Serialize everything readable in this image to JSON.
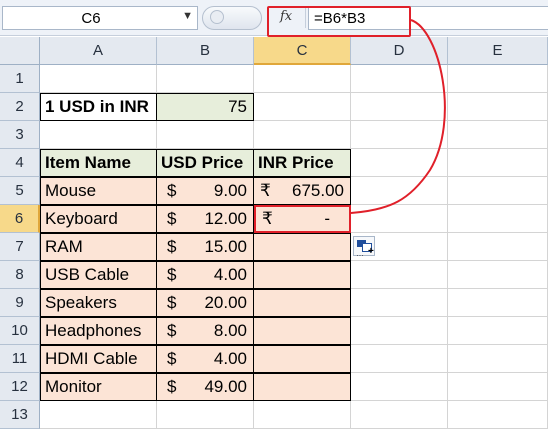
{
  "name_box": {
    "value": "C6",
    "dropdown_icon": "chevron-down-icon"
  },
  "formula_bar": {
    "fx_label": "fx",
    "formula": "=B6*B3"
  },
  "columns": [
    "A",
    "B",
    "C",
    "D",
    "E"
  ],
  "rows": [
    "1",
    "2",
    "3",
    "4",
    "5",
    "6",
    "7",
    "8",
    "9",
    "10",
    "11",
    "12",
    "13"
  ],
  "exchange": {
    "label": "1 USD in INR",
    "value": "75"
  },
  "table": {
    "headers": {
      "item": "Item Name",
      "usd": "USD Price",
      "inr": "INR Price"
    },
    "items": [
      {
        "name": "Mouse",
        "usd_sym": "$",
        "usd": "9.00",
        "inr_sym": "₹",
        "inr": "675.00"
      },
      {
        "name": "Keyboard",
        "usd_sym": "$",
        "usd": "12.00",
        "inr_sym": "₹",
        "inr": "-"
      },
      {
        "name": "RAM",
        "usd_sym": "$",
        "usd": "15.00"
      },
      {
        "name": "USB Cable",
        "usd_sym": "$",
        "usd": "4.00"
      },
      {
        "name": "Speakers",
        "usd_sym": "$",
        "usd": "20.00"
      },
      {
        "name": "Headphones",
        "usd_sym": "$",
        "usd": "8.00"
      },
      {
        "name": "HDMI Cable",
        "usd_sym": "$",
        "usd": "4.00"
      },
      {
        "name": "Monitor",
        "usd_sym": "$",
        "usd": "49.00"
      }
    ]
  },
  "colors": {
    "highlight": "#e0202a",
    "green_fill": "#e7eedb",
    "peach_fill": "#fce4d6",
    "active_header": "#f7d98a"
  },
  "paste_options_icon": "paste-options-icon"
}
